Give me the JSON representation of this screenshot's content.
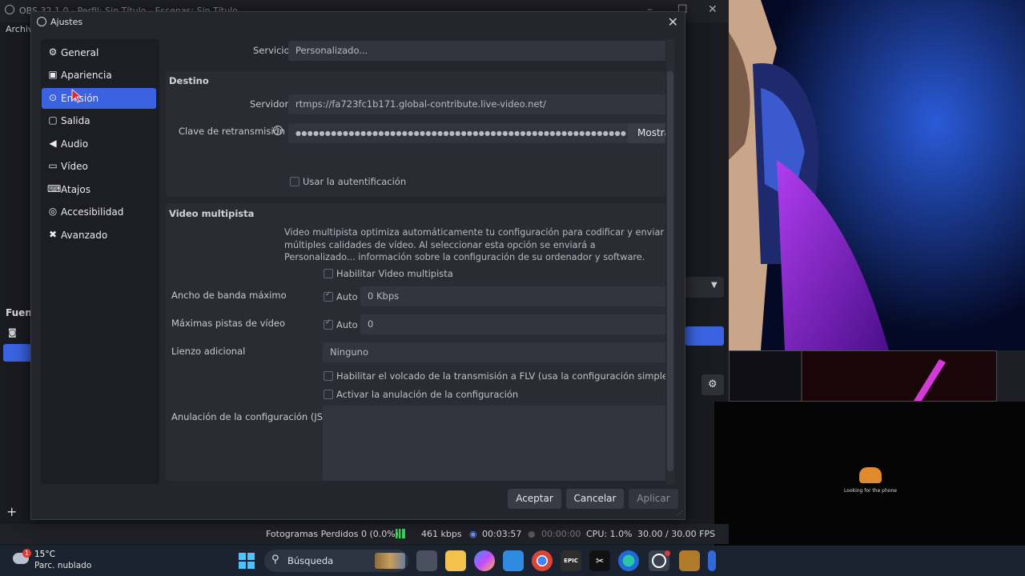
{
  "obs": {
    "window_title": "OBS 32.1.0 - Perfil: Sin Título - Escenas: Sin Título",
    "menu_first": "Archivo",
    "fuentes_label": "Fuentes",
    "status": {
      "frames_lost": "Fotogramas Perdidos 0 (0.0%)",
      "bitrate": "461 kbps",
      "stream_time": "00:03:57",
      "rec_time": "00:00:00",
      "cpu": "CPU: 1.0%",
      "fps": "30.00 / 30.00 FPS"
    },
    "preview_caption": "Looking for the phone"
  },
  "dialog": {
    "title": "Ajustes",
    "nav": [
      {
        "label": "General",
        "icon": "gear-icon"
      },
      {
        "label": "Apariencia",
        "icon": "palette-icon"
      },
      {
        "label": "Emisión",
        "icon": "antenna-icon"
      },
      {
        "label": "Salida",
        "icon": "output-icon"
      },
      {
        "label": "Audio",
        "icon": "speaker-icon"
      },
      {
        "label": "Vídeo",
        "icon": "monitor-icon"
      },
      {
        "label": "Atajos",
        "icon": "keyboard-icon"
      },
      {
        "label": "Accesibilidad",
        "icon": "accessibility-icon"
      },
      {
        "label": "Avanzado",
        "icon": "tools-icon"
      }
    ],
    "servicio_label": "Servicio",
    "servicio_value": "Personalizado...",
    "destino": {
      "heading": "Destino",
      "servidor_label": "Servidor",
      "servidor_value": "rtmps://fa723fc1b171.global-contribute.live-video.net/",
      "clave_label": "Clave de retransmisión",
      "clave_value": "●●●●●●●●●●●●●●●●●●●●●●●●●●●●●●●●●●●●●●●●●●●●●●●●●●●●●●●●",
      "mostrar": "Mostrar",
      "auth_label": "Usar la autentificación"
    },
    "multipista": {
      "heading": "Video multipista",
      "description": "Video multipista optimiza automáticamente tu configuración para codificar y enviar múltiples calidades de vídeo. Al seleccionar esta opción se enviará a Personalizado... información sobre la configuración de su ordenador y software.",
      "enable_label": "Habilitar Video multipista",
      "bandwidth_label": "Ancho de banda máximo",
      "bandwidth_auto": "Auto",
      "bandwidth_value": "0 Kbps",
      "tracks_label": "Máximas pistas de vídeo",
      "tracks_auto": "Auto",
      "tracks_value": "0",
      "canvas_label": "Lienzo adicional",
      "canvas_value": "Ninguno",
      "flv_label": "Habilitar el volcado de la transmisión a FLV (usa la configuración simple de grabación)",
      "override_label": "Activar la anulación de la configuración",
      "json_label": "Anulación de la configuración (JSON)"
    },
    "buttons": {
      "accept": "Aceptar",
      "cancel": "Cancelar",
      "apply": "Aplicar"
    }
  },
  "taskbar": {
    "weather_temp": "15°C",
    "weather_desc": "Parc. nublado",
    "weather_badge": "1",
    "search_label": "Búsqueda",
    "epic_label": "EPIC"
  },
  "colors": {
    "accent": "#3b62e0",
    "dialog_bg": "#24252d",
    "group_bg": "#2a2b33"
  }
}
